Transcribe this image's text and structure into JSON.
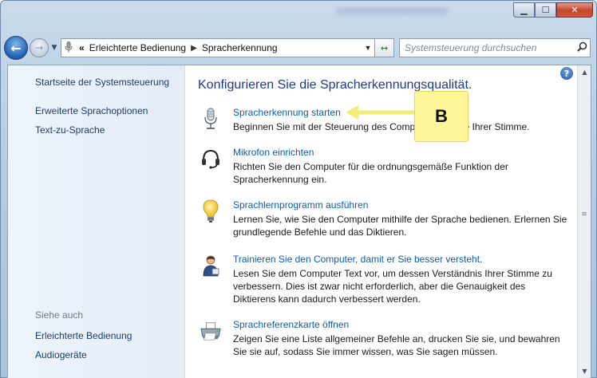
{
  "window": {
    "minimize_glyph": "▁",
    "maximize_glyph": "☐",
    "close_glyph": "✕"
  },
  "nav": {
    "back_glyph": "←",
    "forward_glyph": "→",
    "history_dropdown_glyph": "▼",
    "address_icon": "microphone-icon",
    "overflow": "«",
    "breadcrumb": [
      "Erleichterte Bedienung",
      "Spracherkennung"
    ],
    "separator": "▶",
    "address_dropdown_glyph": "▼",
    "refresh_glyph": "↔",
    "search_placeholder": "Systemsteuerung durchsuchen",
    "search_glyph": "⌕"
  },
  "sidebar": {
    "home": "Startseite der Systemsteuerung",
    "items": [
      {
        "label": "Erweiterte Sprachoptionen"
      },
      {
        "label": "Text-zu-Sprache"
      }
    ],
    "see_also_label": "Siehe auch",
    "see_also": [
      {
        "label": "Erleichterte Bedienung"
      },
      {
        "label": "Audiogeräte"
      }
    ]
  },
  "main": {
    "heading": "Konfigurieren Sie die Spracherkennungsqualität.",
    "help_glyph": "?",
    "tasks": [
      {
        "icon": "microphone-icon",
        "link": "Spracherkennung starten",
        "desc": "Beginnen Sie mit der Steuerung des Computers mithilfe Ihrer Stimme."
      },
      {
        "icon": "headset-icon",
        "link": "Mikrofon einrichten",
        "desc": "Richten Sie den Computer für die ordnungsgemäße Funktion der Spracherkennung ein."
      },
      {
        "icon": "lightbulb-icon",
        "link": "Sprachlernprogramm ausführen",
        "desc": "Lernen Sie, wie Sie den Computer mithilfe der Sprache bedienen. Erlernen Sie grundlegende Befehle und das Diktieren."
      },
      {
        "icon": "user-training-icon",
        "link": "Trainieren Sie den Computer, damit er Sie besser versteht.",
        "desc": "Lesen Sie dem Computer Text vor, um dessen Verständnis Ihrer Stimme zu verbessern. Dies ist zwar nicht erforderlich, aber die Genauigkeit des Diktierens kann dadurch verbessert werden."
      },
      {
        "icon": "printer-icon",
        "link": "Sprachreferenzkarte öffnen",
        "desc": "Zeigen Sie eine Liste allgemeiner Befehle an, drucken Sie sie, und bewahren Sie sie auf, sodass Sie immer wissen, was Sie sagen müssen."
      }
    ]
  },
  "scrollbar": {
    "up_glyph": "▲",
    "down_glyph": "▼",
    "grip_glyph": "≡"
  },
  "callout": {
    "label": "B",
    "color": "#fff79a"
  }
}
